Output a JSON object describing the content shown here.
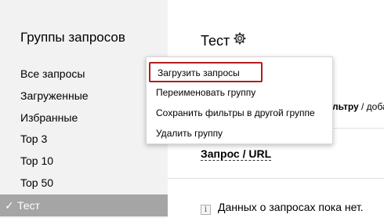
{
  "sidebar": {
    "title": "Группы запросов",
    "items": [
      {
        "label": "Все запросы"
      },
      {
        "label": "Загруженные"
      },
      {
        "label": "Избранные"
      },
      {
        "label": "Top 3"
      },
      {
        "label": "Top 10"
      },
      {
        "label": "Top 50"
      }
    ],
    "active_item": {
      "check": "✓",
      "label": "Тест"
    }
  },
  "main": {
    "group_title": "Тест",
    "filter_text_bold": "льтру",
    "filter_text_rest": " / доба",
    "column_header": "Запрос / URL",
    "empty_message": "Данных о запросах пока нет."
  },
  "menu": {
    "items": [
      {
        "label": "Загрузить запросы"
      },
      {
        "label": "Переименовать группу"
      },
      {
        "label": "Сохранить фильтры в другой группе"
      },
      {
        "label": "Удалить группу"
      }
    ]
  },
  "colors": {
    "sidebar_bg": "#f2f2f2",
    "active_bg": "#a5a5a5",
    "highlight_border": "#b01e1e"
  },
  "icons": {
    "gear": "gear-icon",
    "info": "info-icon",
    "check": "checkmark-icon"
  }
}
